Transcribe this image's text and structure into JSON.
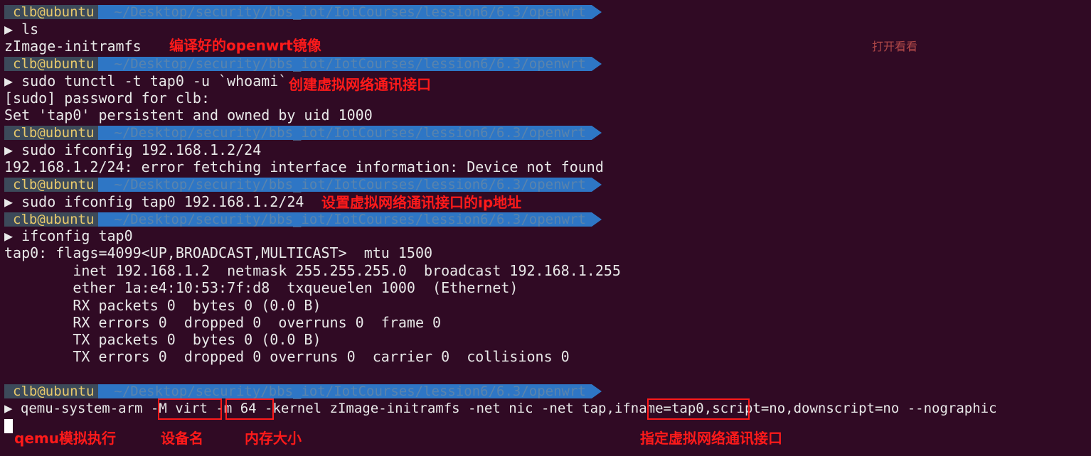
{
  "prompt": {
    "user": "clb@ubuntu",
    "path": "~/Desktop/security/bbs_iot/IotCourses/lession6/6.3/openwrt"
  },
  "lines": {
    "l1": "▶ ls",
    "l2": "zImage-initramfs",
    "l3": "▶ sudo tunctl -t tap0 -u `whoami`",
    "l4": "[sudo] password for clb:",
    "l5": "Set 'tap0' persistent and owned by uid 1000",
    "l6": "▶ sudo ifconfig 192.168.1.2/24",
    "l7": "192.168.1.2/24: error fetching interface information: Device not found",
    "l8": "▶ sudo ifconfig tap0 192.168.1.2/24",
    "l9": "▶ ifconfig tap0",
    "l10": "tap0: flags=4099<UP,BROADCAST,MULTICAST>  mtu 1500",
    "l11": "        inet 192.168.1.2  netmask 255.255.255.0  broadcast 192.168.1.255",
    "l12": "        ether 1a:e4:10:53:7f:d8  txqueuelen 1000  (Ethernet)",
    "l13": "        RX packets 0  bytes 0 (0.0 B)",
    "l14": "        RX errors 0  dropped 0  overruns 0  frame 0",
    "l15": "        TX packets 0  bytes 0 (0.0 B)",
    "l16": "        TX errors 0  dropped 0 overruns 0  carrier 0  collisions 0",
    "l17": "▶ qemu-system-arm -M virt -m 64 -kernel zImage-initramfs -net nic -net tap,ifname=tap0,script=no,downscript=no --nographic"
  },
  "annotations": {
    "n1": "编译好的openwrt镜像",
    "n2": "打开看看",
    "n3": "创建虚拟网络通讯接口",
    "n4": "设置虚拟网络通讯接口的ip地址",
    "n5": "qemu模拟执行",
    "n6": "设备名",
    "n7": "内存大小",
    "n8": "指定虚拟网络通讯接口"
  },
  "colors": {
    "background": "#300a24",
    "annotation": "#ff1a1a",
    "prompt_user_bg": "#3c4a5a",
    "prompt_user_fg": "#e8c96b",
    "prompt_path_bg": "#2e76c5"
  }
}
